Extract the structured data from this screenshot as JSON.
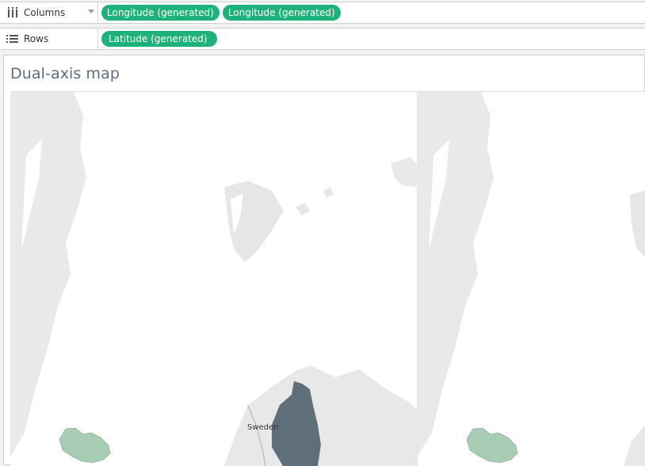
{
  "shelves": {
    "columns": {
      "label": "Columns",
      "pills": [
        "Longitude (generated)",
        "Longitude (generated)"
      ]
    },
    "rows": {
      "label": "Rows",
      "pills": [
        "Latitude (generated)"
      ]
    }
  },
  "viz": {
    "title": "Dual-axis map",
    "map_label": "Sweden"
  },
  "colors": {
    "pill": "#1fb17b",
    "land": "#e8e8e8",
    "iceland": "#a8cdb4",
    "finland": "#5f6f7a",
    "title": "#5d6d7e"
  }
}
